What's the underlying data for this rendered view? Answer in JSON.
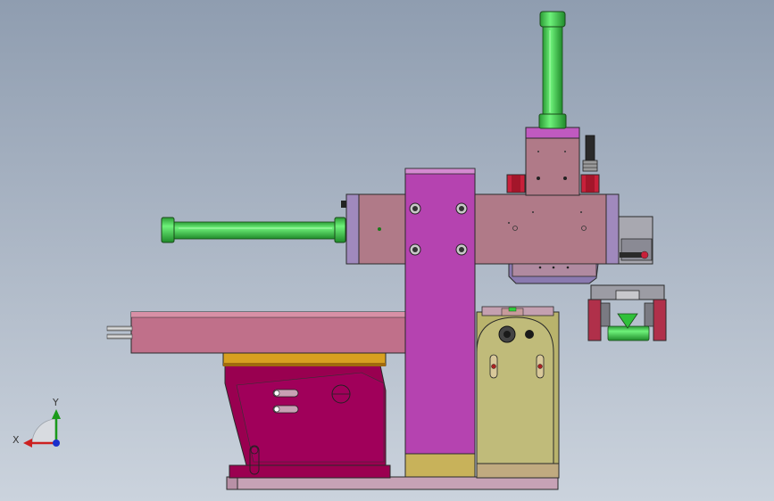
{
  "triad": {
    "x_label": "X",
    "y_label": "Y",
    "colors": {
      "x": "#cc2020",
      "y": "#1a9a1a",
      "z": "#1a2fcc"
    }
  },
  "colors": {
    "magenta_column": "#b543b0",
    "pink_arm": "#b07a8a",
    "green_cylinder": "#3fd04a",
    "crimson_base": "#990050",
    "olive_block": "#b6b06a",
    "gold_plate": "#d8a020",
    "red_clamp": "#c8203a"
  }
}
